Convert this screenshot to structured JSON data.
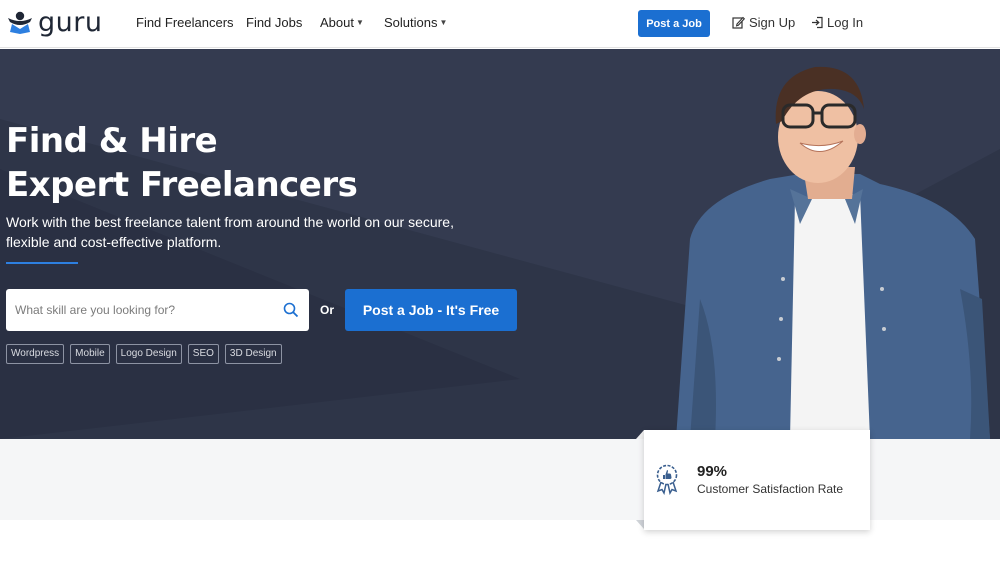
{
  "nav": {
    "logo_text": "guru",
    "links": [
      {
        "label": "Find Freelancers"
      },
      {
        "label": "Find Jobs"
      },
      {
        "label": "About"
      },
      {
        "label": "Solutions"
      }
    ],
    "post_job_label": "Post a Job",
    "sign_up_label": "Sign Up",
    "log_in_label": "Log In"
  },
  "hero": {
    "title_line1": "Find & Hire",
    "title_line2": "Expert Freelancers",
    "subtitle": "Work with the best freelance talent from around the world on our secure, flexible and cost-effective platform.",
    "search_placeholder": "What skill are you looking for?",
    "or_label": "Or",
    "post_job_label": "Post a Job - It's Free",
    "tags": [
      "Wordpress",
      "Mobile",
      "Logo Design",
      "SEO",
      "3D Design"
    ]
  },
  "stat_card": {
    "value": "99%",
    "label": "Customer Satisfaction Rate"
  },
  "colors": {
    "brand_blue": "#1b6fd1",
    "hero_bg": "#2e3548",
    "shirt": "#46648e"
  },
  "icons": [
    "guru-logo-icon",
    "chevron-down-icon",
    "edit-icon",
    "login-icon",
    "search-icon",
    "award-ribbon-icon"
  ]
}
